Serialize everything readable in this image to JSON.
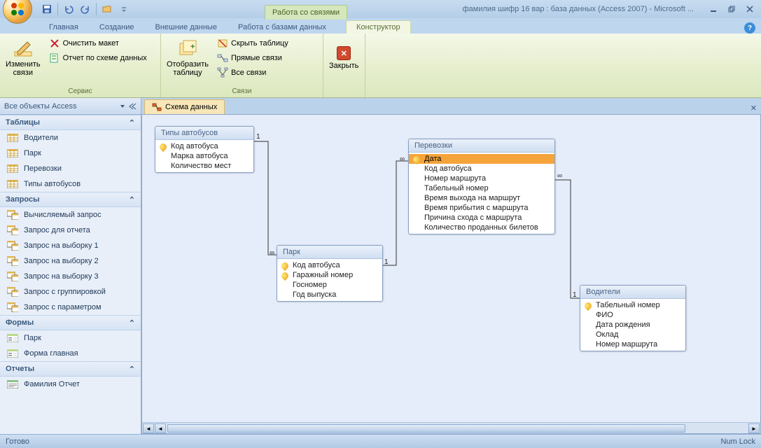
{
  "title": "фамилия шифр 16 вар : база данных (Access 2007) - Microsoft ...",
  "context_tab_group": "Работа со связями",
  "tabs": {
    "home": "Главная",
    "create": "Создание",
    "external": "Внешние данные",
    "dbtools": "Работа с базами данных",
    "designer": "Конструктор"
  },
  "ribbon": {
    "edit_rel": "Изменить\nсвязи",
    "clear_layout": "Очистить макет",
    "rel_report": "Отчет по схеме данных",
    "group_service": "Сервис",
    "show_table": "Отобразить\nтаблицу",
    "hide_table": "Скрыть таблицу",
    "direct_rel": "Прямые связи",
    "all_rel": "Все связи",
    "group_rel": "Связи",
    "close": "Закрыть"
  },
  "nav": {
    "header": "Все объекты Access",
    "cat_tables": "Таблицы",
    "tables": [
      "Водители",
      "Парк",
      "Перевозки",
      "Типы автобусов"
    ],
    "cat_queries": "Запросы",
    "queries": [
      "Вычисляемый запрос",
      "Запрос для отчета",
      "Запрос на выборку 1",
      "Запрос на выборку 2",
      "Запрос на выборку 3",
      "Запрос с группировкой",
      "Запрос с параметром"
    ],
    "cat_forms": "Формы",
    "forms": [
      "Парк",
      "Форма главная"
    ],
    "cat_reports": "Отчеты",
    "reports": [
      "Фамилия Отчет"
    ]
  },
  "doc_tab": "Схема данных",
  "boxes": {
    "types": {
      "title": "Типы автобусов",
      "fields": [
        "Код автобуса",
        "Марка автобуса",
        "Количество мест"
      ]
    },
    "park": {
      "title": "Парк",
      "fields": [
        "Код автобуса",
        "Гаражный номер",
        "Госномер",
        "Год выпуска"
      ]
    },
    "trips": {
      "title": "Перевозки",
      "fields": [
        "Дата",
        "Код автобуса",
        "Номер маршрута",
        "Табельный номер",
        "Время выхода на маршрут",
        "Время прибытия с маршрута",
        "Причина схода с маршрута",
        "Количество проданных билетов"
      ]
    },
    "drivers": {
      "title": "Водители",
      "fields": [
        "Табельный номер",
        "ФИО",
        "Дата рождения",
        "Оклад",
        "Номер маршрута"
      ]
    }
  },
  "status": {
    "ready": "Готово",
    "numlock": "Num Lock"
  }
}
